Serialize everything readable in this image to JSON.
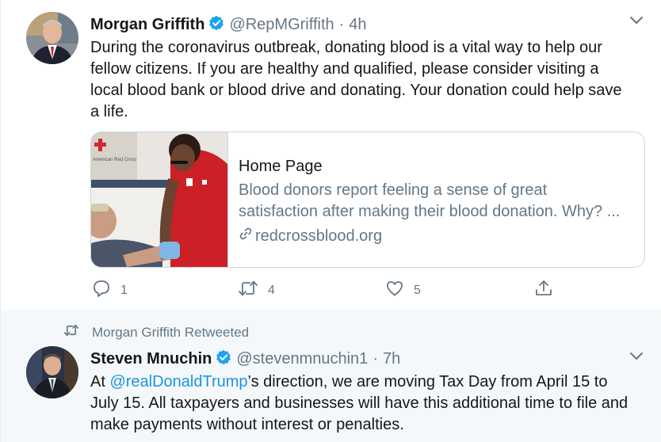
{
  "tweet1": {
    "name": "Morgan Griffith",
    "handle": "@RepMGriffith",
    "separator": "·",
    "time": "4h",
    "text_lines": [
      "During the coronavirus outbreak, donating blood is a vital way to help our",
      "fellow citizens. If you are healthy and qualified, please consider visiting a",
      "local blood bank or blood drive and donating. Your donation could help save",
      "a life."
    ],
    "card": {
      "title": "Home Page",
      "description_lines": [
        "Blood donors report feeling a sense of great",
        "satisfaction after making their blood donation. Why? ..."
      ],
      "domain": "redcrossblood.org",
      "image_text": "American Red Cross"
    },
    "actions": {
      "reply_count": "1",
      "retweet_count": "4",
      "like_count": "5"
    }
  },
  "tweet2": {
    "retweeted_by": "Morgan Griffith Retweeted",
    "name": "Steven Mnuchin",
    "handle": "@stevenmnuchin1",
    "separator": "·",
    "time": "7h",
    "text_prefix": "At ",
    "mention": "@realDonaldTrump",
    "text_after_mention": "’s direction, we are moving Tax Day from April 15 to",
    "text_lines": [
      "July 15. All taxpayers and businesses will have this additional time to file and",
      "make payments without interest or penalties."
    ]
  },
  "colors": {
    "text": "#14171a",
    "secondary": "#657786",
    "link": "#1b95e0",
    "verified": "#1da1f2",
    "retweet_bg": "#f5f8fa"
  },
  "icons": {
    "verified": "verified-badge-icon",
    "chevron": "chevron-down-icon",
    "reply": "reply-icon",
    "retweet": "retweet-icon",
    "like": "heart-icon",
    "share": "share-icon",
    "link": "link-icon"
  }
}
